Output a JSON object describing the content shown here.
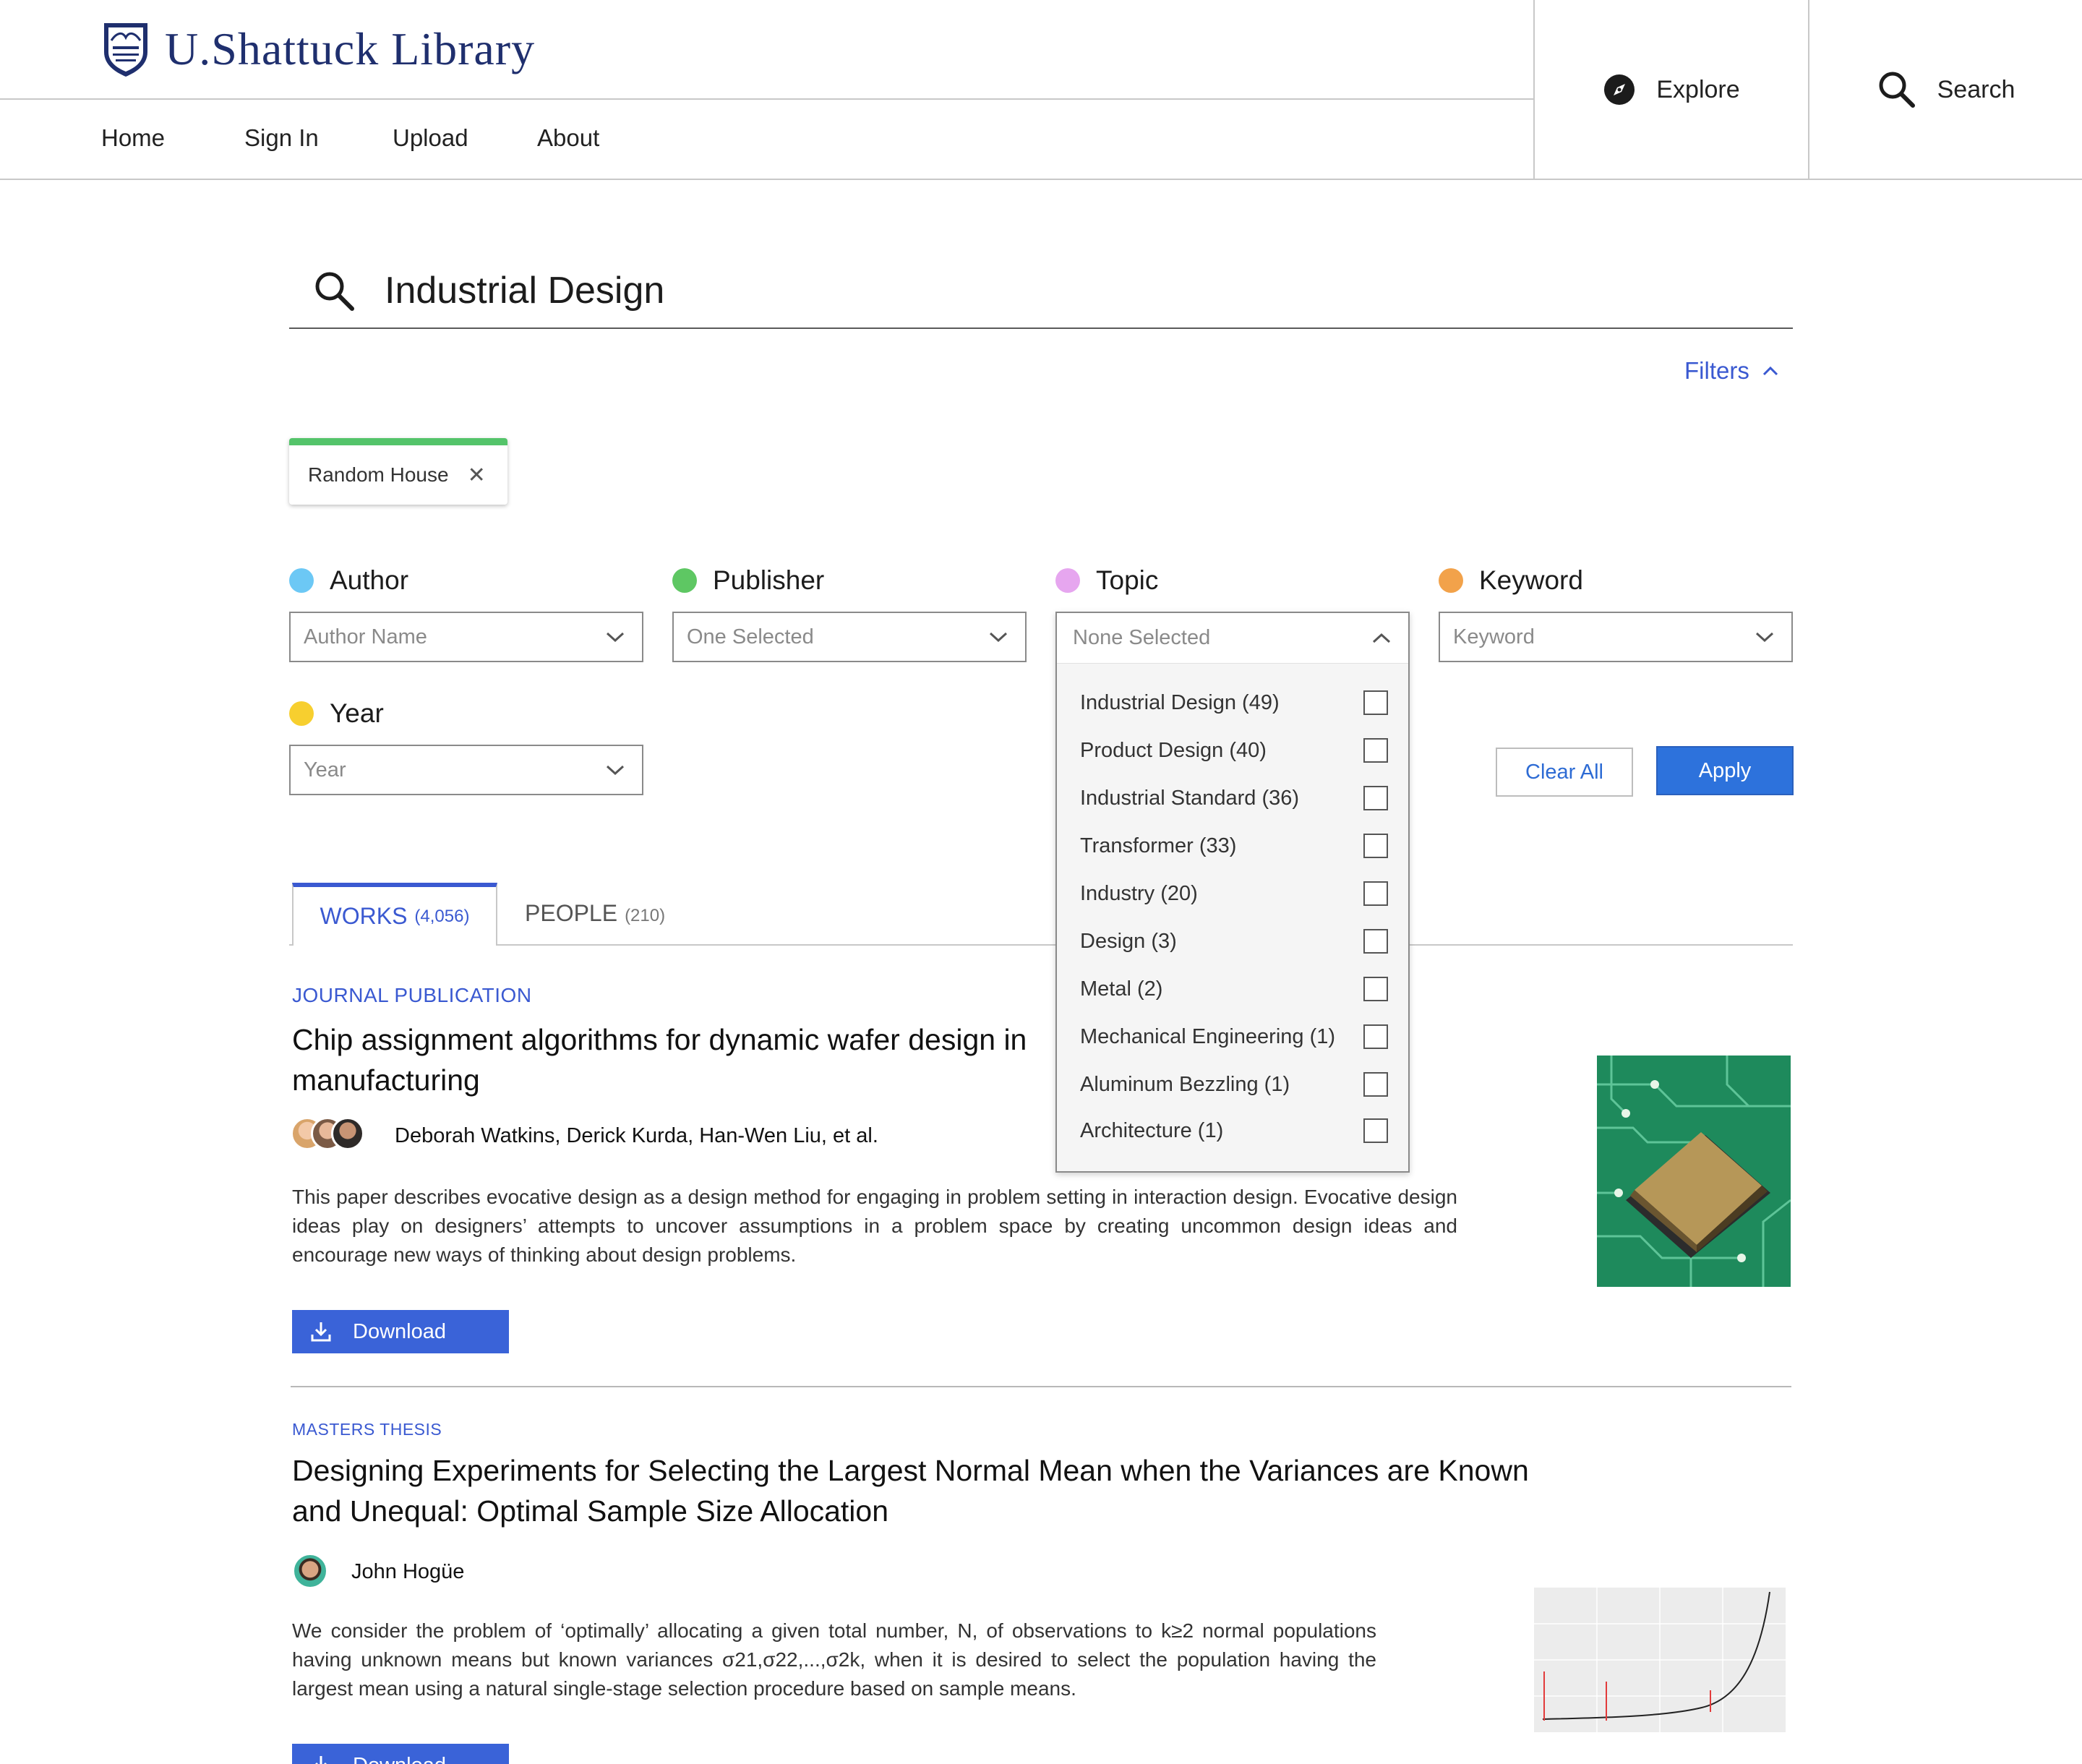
{
  "brand": {
    "name": "U.Shattuck Library"
  },
  "nav": {
    "home": "Home",
    "sign_in": "Sign In",
    "upload": "Upload",
    "about": "About"
  },
  "header_buttons": {
    "explore": "Explore",
    "search": "Search"
  },
  "search": {
    "query": "Industrial Design"
  },
  "filters": {
    "toggle_label": "Filters",
    "active_chip": "Random House",
    "groups": [
      {
        "label": "Author",
        "value": "Author Name",
        "color": "#6cc8f5"
      },
      {
        "label": "Publisher",
        "value": "One Selected",
        "color": "#5ec763"
      },
      {
        "label": "Topic",
        "value": "None Selected",
        "color": "#e6a6ef"
      },
      {
        "label": "Keyword",
        "value": "Keyword",
        "color": "#f2a24a"
      },
      {
        "label": "Year",
        "value": "Year",
        "color": "#f7cf2f"
      }
    ],
    "topic_options": [
      "Industrial Design (49)",
      "Product Design (40)",
      "Industrial Standard (36)",
      "Transformer (33)",
      "Industry (20)",
      "Design (3)",
      "Metal (2)",
      "Mechanical Engineering (1)",
      "Aluminum Bezzling (1)",
      "Architecture (1)"
    ],
    "clear_all": "Clear All",
    "apply": "Apply"
  },
  "tabs": {
    "works": {
      "label": "WORKS",
      "count": "(4,056)"
    },
    "people": {
      "label": "PEOPLE",
      "count": "(210)"
    }
  },
  "results": [
    {
      "type": "JOURNAL PUBLICATION",
      "title_line1": "Chip assignment algorithms for dynamic wafer design in",
      "title_line2": "manufacturing",
      "authors": "Deborah Watkins, Derick Kurda, Han-Wen Liu, et al.",
      "description": "This paper describes evocative design as a design method for engaging in problem setting in interaction design. Evocative design ideas play on designers’ attempts to uncover assumptions in a problem space by creating uncommon design ideas and encourage new ways of thinking about design problems.",
      "download": "Download"
    },
    {
      "type": "MASTERS THESIS",
      "title_line1": "Designing Experiments for Selecting the Largest Normal Mean when the Variances are Known",
      "title_line2": "and Unequal: Optimal Sample Size Allocation",
      "authors": "John Hogüe",
      "description": "We consider the problem of ‘optimally’ allocating a given total number, N, of observations to k≥2 normal populations having unknown means but known variances σ21,σ22,...,σ2k, when it is desired to select the population having the largest mean using a natural single-stage selection procedure based on sample means.",
      "download": "Download"
    }
  ],
  "colors": {
    "accent": "#3a59d1",
    "apply": "#2d72dc",
    "chip_bar": "#54c46a"
  }
}
